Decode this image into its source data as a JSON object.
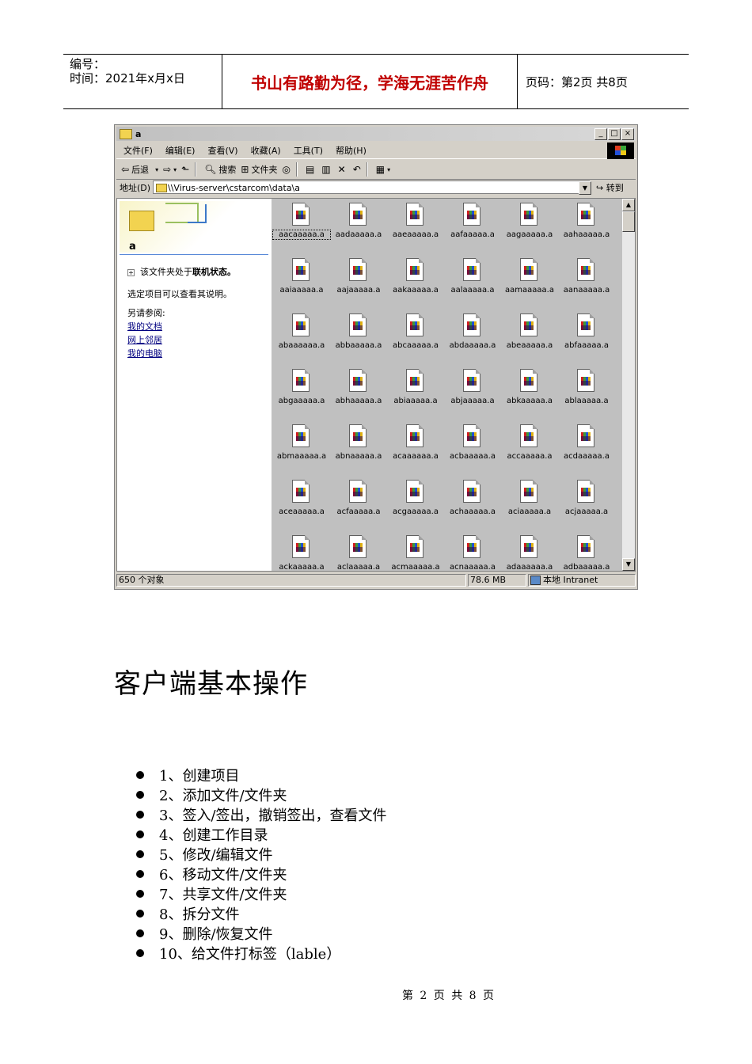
{
  "header": {
    "number_label": "编号：",
    "time_label": "时间：2021年x月x日",
    "motto": "书山有路勤为径，学海无涯苦作舟",
    "page_info": "页码：第2页  共8页"
  },
  "explorer": {
    "title": "a",
    "window_buttons": {
      "minimize": "_",
      "maximize": "□",
      "close": "×"
    },
    "menu": [
      "文件(F)",
      "编辑(E)",
      "查看(V)",
      "收藏(A)",
      "工具(T)",
      "帮助(H)"
    ],
    "toolbar": {
      "back": "后退",
      "back_glyph": "⇦",
      "forward_glyph": "⇨",
      "search": "搜索",
      "folders": "文件夹"
    },
    "address": {
      "label": "地址(D)",
      "value": "\\\\Virus-server\\cstarcom\\data\\a",
      "go": "转到"
    },
    "left_pane": {
      "folder_name": "a",
      "online_status_prefix": "该文件夹处于",
      "online_status_bold": "联机状态。",
      "hint": "选定项目可以查看其说明。",
      "see_also": "另请参阅:",
      "links": [
        "我的文档",
        "网上邻居",
        "我的电脑"
      ]
    },
    "files": [
      "aacaaaaa.a",
      "aadaaaaa.a",
      "aaeaaaaa.a",
      "aafaaaaa.a",
      "aagaaaaa.a",
      "aahaaaaa.a",
      "aaiaaaaa.a",
      "aajaaaaa.a",
      "aakaaaaa.a",
      "aalaaaaa.a",
      "aamaaaaa.a",
      "aanaaaaa.a",
      "abaaaaaa.a",
      "abbaaaaa.a",
      "abcaaaaa.a",
      "abdaaaaa.a",
      "abeaaaaa.a",
      "abfaaaaa.a",
      "abgaaaaa.a",
      "abhaaaaa.a",
      "abiaaaaa.a",
      "abjaaaaa.a",
      "abkaaaaa.a",
      "ablaaaaa.a",
      "abmaaaaa.a",
      "abnaaaaa.a",
      "acaaaaaa.a",
      "acbaaaaa.a",
      "accaaaaa.a",
      "acdaaaaa.a",
      "aceaaaaa.a",
      "acfaaaaa.a",
      "acgaaaaa.a",
      "achaaaaa.a",
      "aciaaaaa.a",
      "acjaaaaa.a",
      "ackaaaaa.a",
      "aclaaaaa.a",
      "acmaaaaa.a",
      "acnaaaaa.a",
      "adaaaaaa.a",
      "adbaaaaa.a"
    ],
    "status": {
      "objects": "650 个对象",
      "size": "78.6 MB",
      "zone": "本地 Intranet"
    }
  },
  "section": {
    "heading": "客户端基本操作",
    "items": [
      "1、创建项目",
      "2、添加文件/文件夹",
      "3、签入/签出，撤销签出，查看文件",
      "4、创建工作目录",
      "5、修改/编辑文件",
      "6、移动文件/文件夹",
      "7、共享文件/文件夹",
      "8、拆分文件",
      "9、删除/恢复文件",
      "10、给文件打标签（lable）"
    ]
  },
  "footer": {
    "page": "第 2 页 共 8 页"
  }
}
